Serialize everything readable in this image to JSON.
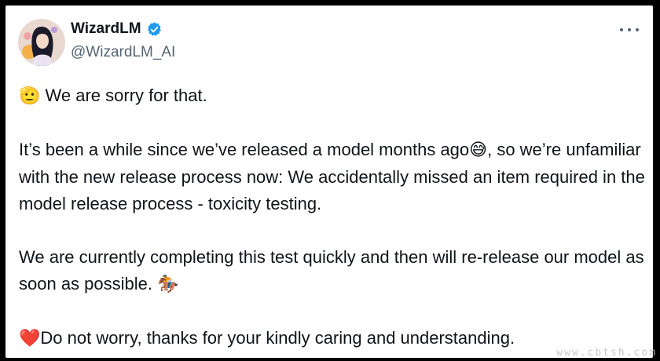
{
  "tweet": {
    "display_name": "WizardLM",
    "handle": "@WizardLM_AI",
    "more_icon": "more-horizontal-icon",
    "verified_color": "#1d9bf0",
    "paragraphs": [
      {
        "emoji_lead": "🫡",
        "text": " We are sorry for that."
      },
      {
        "text_a": "It’s been a while since we’ve released a model months ago",
        "emoji": "😅",
        "text_b": ", so we’re unfamiliar with the new release process now: We accidentally missed an item required in the model release process - toxicity testing."
      },
      {
        "text": "We are currently completing this test quickly and then will re-release our model as soon as possible. ",
        "emoji": "🏇"
      },
      {
        "emoji_lead": "❤️",
        "text": "Do not worry, thanks for your kindly caring and understanding."
      }
    ]
  },
  "watermark": "www.cbtsh.com",
  "colors": {
    "text": "#0f1419",
    "muted": "#536471",
    "background": "#000000"
  }
}
